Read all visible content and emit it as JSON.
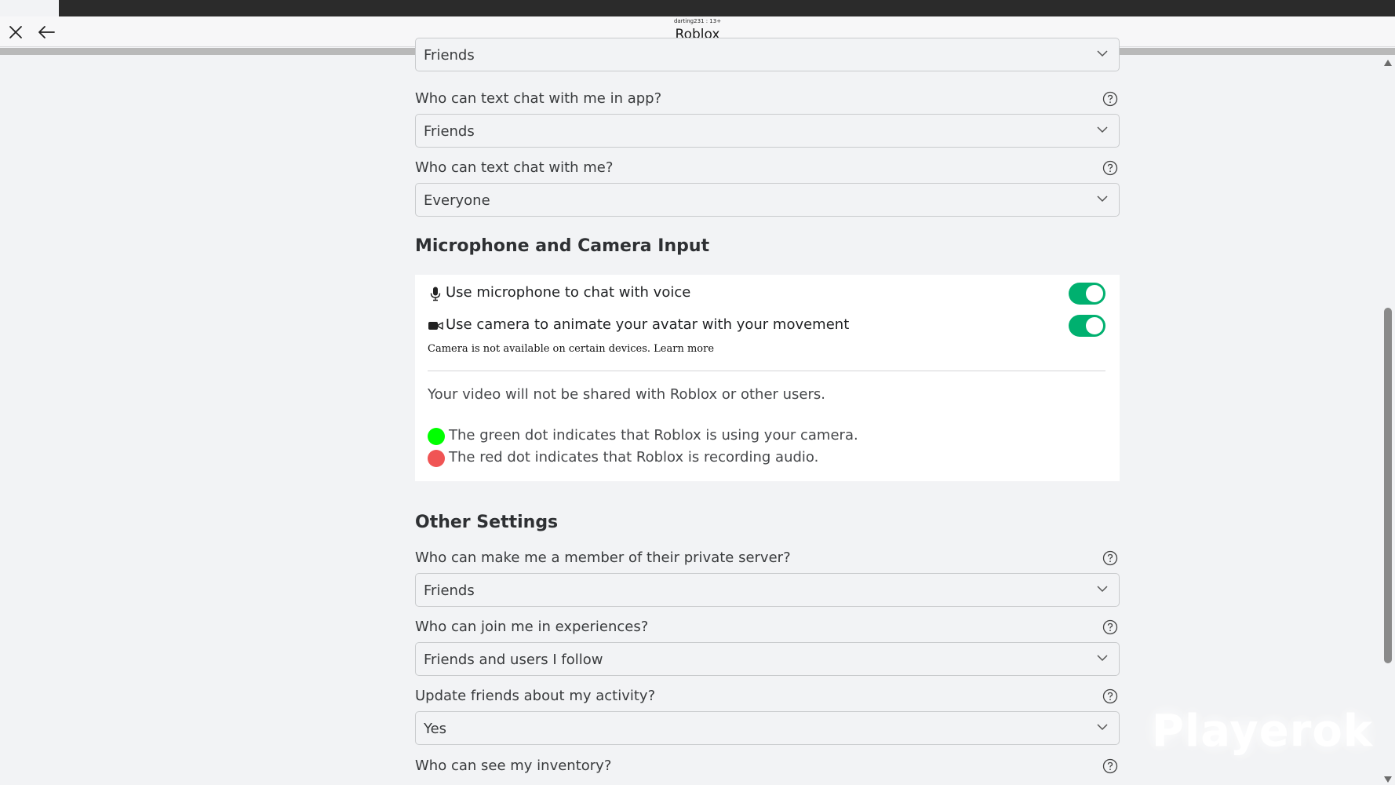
{
  "window": {
    "user_line": "darting231 : 13+",
    "title": "Roblox"
  },
  "chat": {
    "partial_value": "Friends",
    "in_app": {
      "question": "Who can text chat with me in app?",
      "value": "Friends"
    },
    "text_chat": {
      "question": "Who can text chat with me?",
      "value": "Everyone"
    }
  },
  "media": {
    "section_title": "Microphone and Camera Input",
    "mic_label": "Use microphone to chat with voice",
    "mic_on": true,
    "camera_label": "Use camera to animate your avatar with your movement",
    "camera_on": true,
    "camera_note": "Camera is not available on certain devices.",
    "learn_more": "Learn more",
    "video_info": "Your video will not be shared with Roblox or other users.",
    "green_dot_text": "The green dot indicates that Roblox is using your camera.",
    "red_dot_text": "The red dot indicates that Roblox is recording audio.",
    "colors": {
      "toggle_on": "#00b06f",
      "green_dot": "#00ff00",
      "red_dot": "#f05454"
    }
  },
  "other": {
    "section_title": "Other Settings",
    "private_server": {
      "question": "Who can make me a member of their private server?",
      "value": "Friends"
    },
    "join": {
      "question": "Who can join me in experiences?",
      "value": "Friends and users I follow"
    },
    "activity": {
      "question": "Update friends about my activity?",
      "value": "Yes"
    },
    "inventory": {
      "question": "Who can see my inventory?"
    }
  },
  "watermark": "Playerok",
  "icons": [
    "close-icon",
    "back-arrow-icon",
    "chevron-down-icon",
    "help-icon",
    "microphone-icon",
    "camera-icon"
  ]
}
